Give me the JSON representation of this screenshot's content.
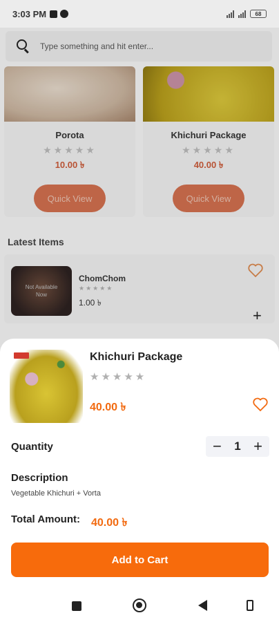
{
  "status_bar": {
    "time": "3:03 PM",
    "battery": "68"
  },
  "search": {
    "placeholder": "Type something and hit enter..."
  },
  "products": [
    {
      "name": "Porota",
      "stars": "★★★★★",
      "price": "10.00 ৳",
      "button": "Quick View"
    },
    {
      "name": "Khichuri Package",
      "stars": "★★★★★",
      "price": "40.00 ৳",
      "button": "Quick View"
    }
  ],
  "latest": {
    "section_title": "Latest Items",
    "item": {
      "name": "ChomChom",
      "stars": "★★★★★",
      "price": "1.00 ৳",
      "overlay_text": "Not Available Now",
      "add_symbol": "+"
    }
  },
  "sheet": {
    "title": "Khichuri Package",
    "stars": "★★★★★",
    "price": "40.00 ৳",
    "quantity_label": "Quantity",
    "quantity_value": "1",
    "minus": "−",
    "plus": "+",
    "description_label": "Description",
    "description_text": "Vegetable Khichuri + Vorta",
    "total_label": "Total Amount:",
    "total_value": "40.00 ৳",
    "add_button": "Add to Cart"
  },
  "colors": {
    "accent": "#f76b0c",
    "price": "#f26a10",
    "background_button": "#cf6e4e"
  }
}
